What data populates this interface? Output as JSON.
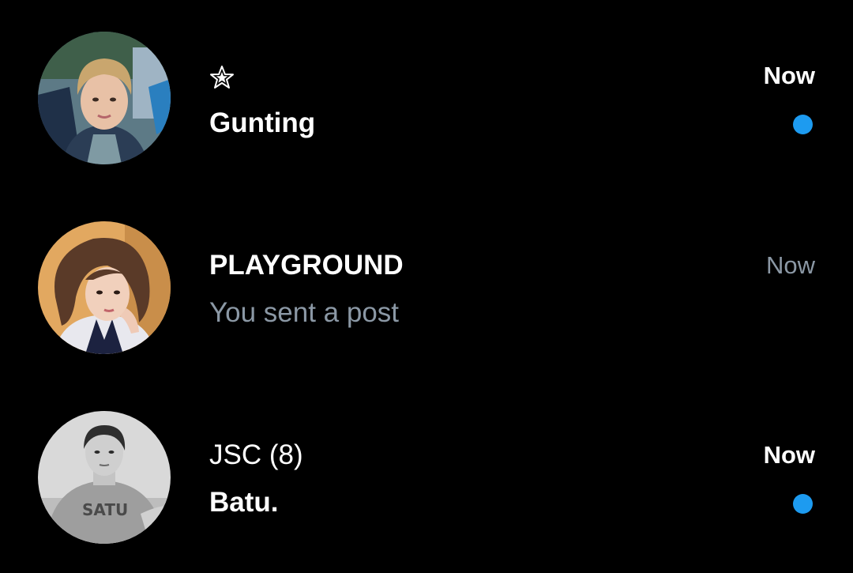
{
  "conversations": [
    {
      "title": "☆",
      "preview": "Gunting",
      "time": "Now",
      "unread": true,
      "avatar_icon": "person-photo-blond-hair",
      "unread_dot_color": "#1d9bf0"
    },
    {
      "title": "PLAYGROUND",
      "preview": "You sent a post",
      "time": "Now",
      "unread": false,
      "avatar_icon": "person-photo-short-brown-hair"
    },
    {
      "title": "JSC (8)",
      "preview": "Batu.",
      "time": "Now",
      "unread": true,
      "avatar_icon": "person-photo-grayscale",
      "unread_dot_color": "#1d9bf0"
    }
  ],
  "colors": {
    "background": "#000000",
    "primary_text": "#ffffff",
    "secondary_text": "#8b98a5",
    "accent": "#1d9bf0"
  }
}
